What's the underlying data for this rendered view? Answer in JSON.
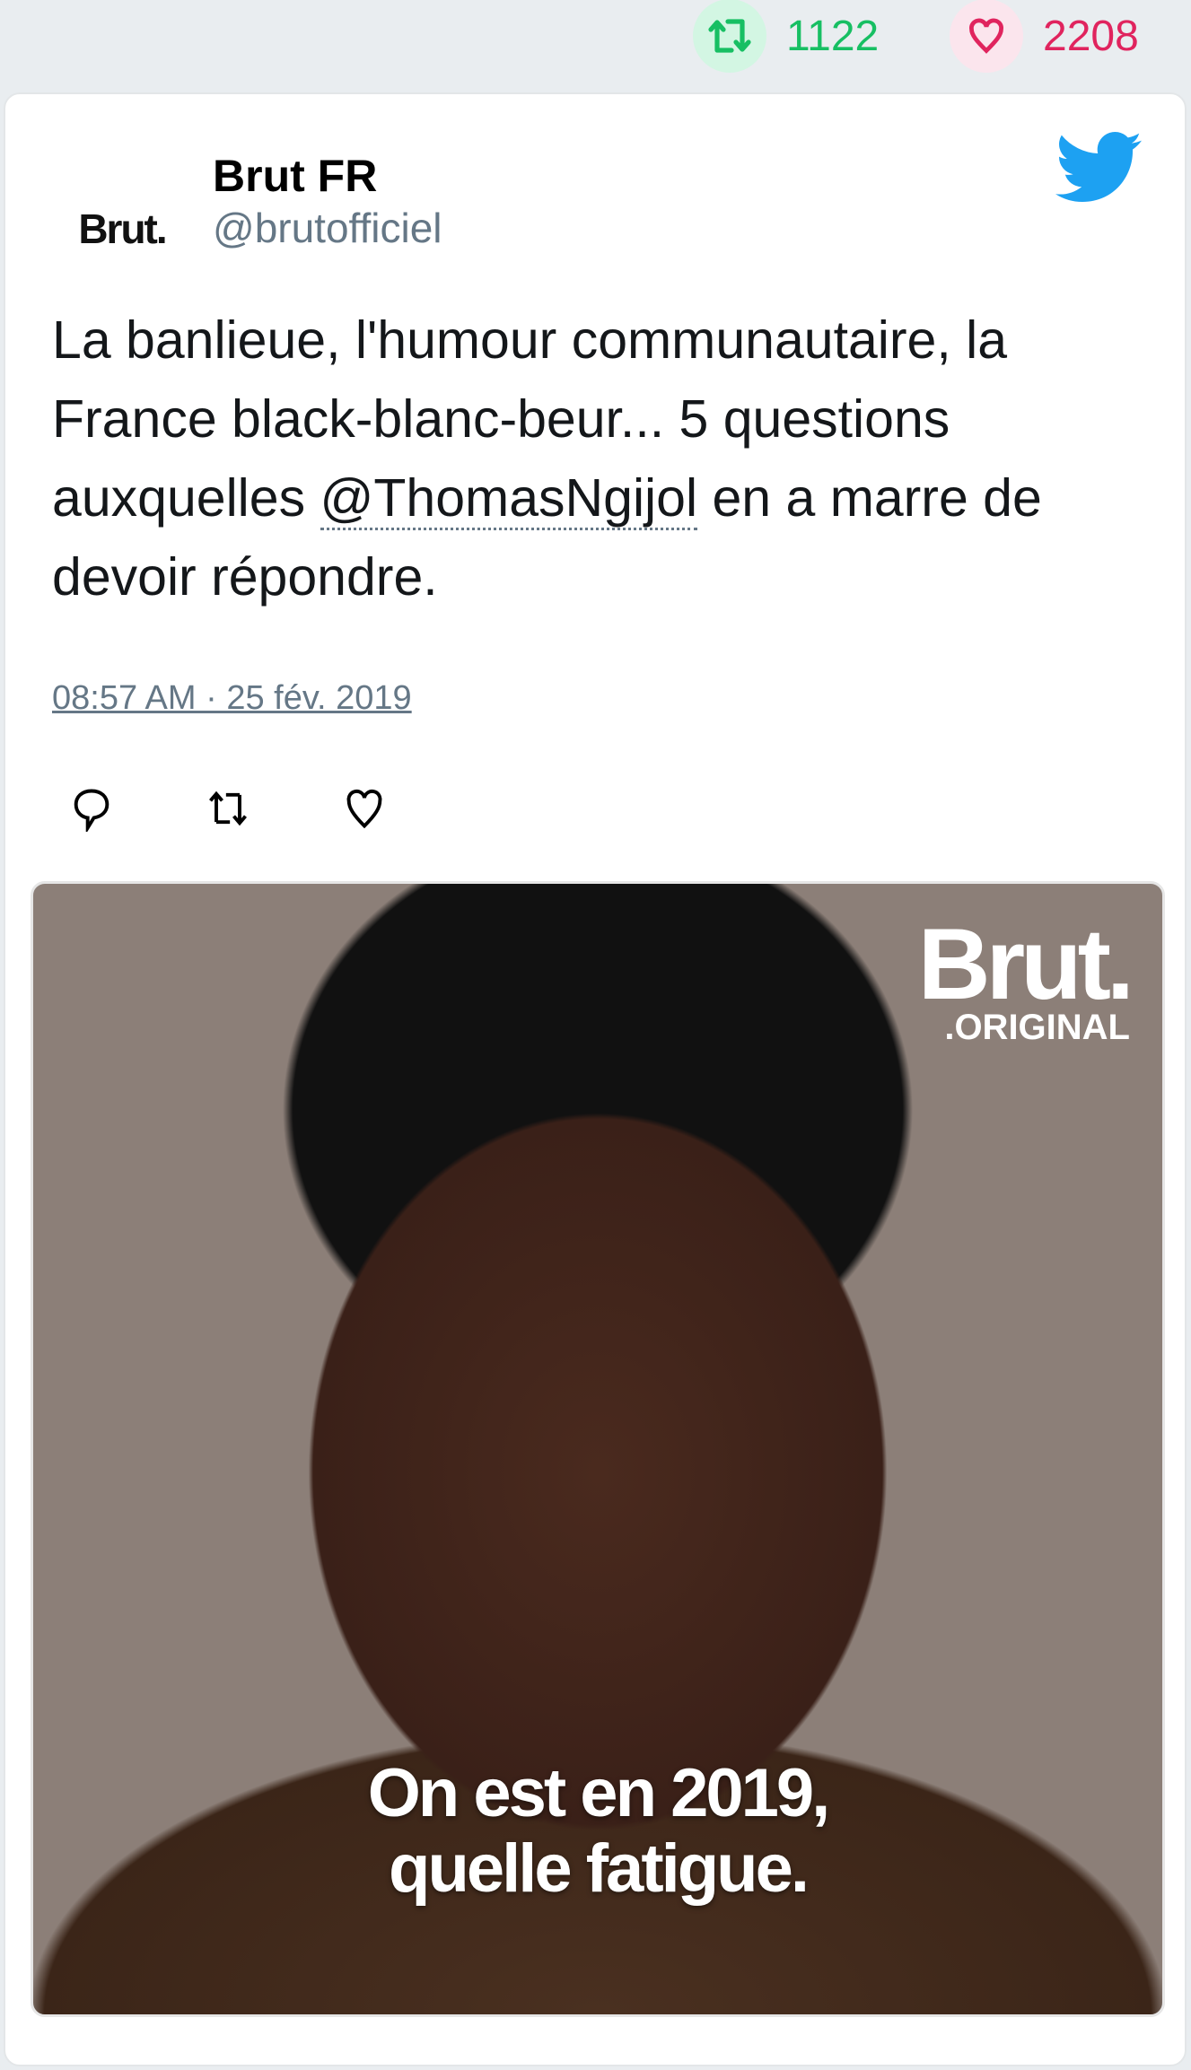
{
  "stats": {
    "retweets": "1122",
    "likes": "2208",
    "retweet_color": "#17bf63",
    "like_color": "#e0245e"
  },
  "tweet": {
    "avatar_text": "Brut.",
    "name": "Brut FR",
    "handle": "@brutofficiel",
    "text_before": "La banlieue, l'humour communautaire, la France black-blanc-beur... 5 questions auxquelles ",
    "mention": "@ThomasNgijol",
    "text_after": " en a marre de devoir répondre.",
    "timestamp": "08:57 AM · 25 fév. 2019",
    "accent": "#1da1f2"
  },
  "media": {
    "logo": "Brut.",
    "logo_sub": ".ORIGINAL",
    "caption_line1": "On est en 2019,",
    "caption_line2": "quelle fatigue."
  }
}
